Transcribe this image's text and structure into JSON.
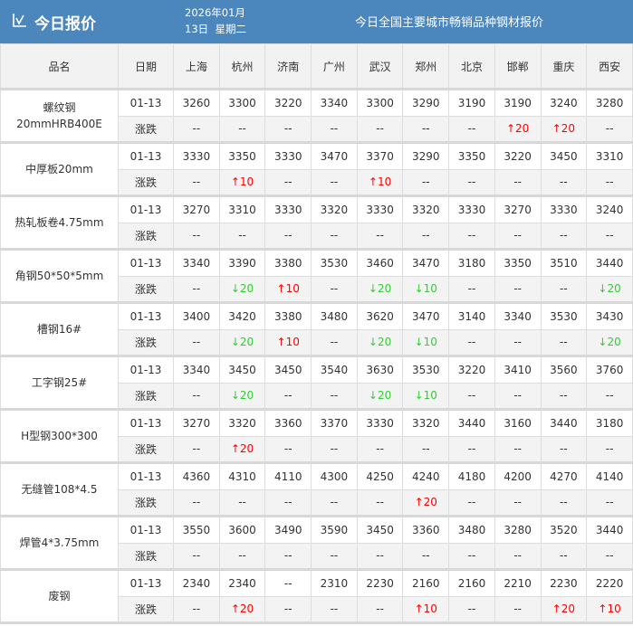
{
  "header": {
    "title": "今日报价",
    "date_line1": "2026年01月",
    "date_line2": "13日  星期二",
    "subtitle": "今日全国主要城市畅销品种钢材报价"
  },
  "colors": {
    "header_bg": "#4b86bd",
    "up": "#ff0000",
    "down": "#33cc33"
  },
  "table": {
    "col_name": "品名",
    "col_date": "日期",
    "cities": [
      "上海",
      "杭州",
      "济南",
      "广州",
      "武汉",
      "郑州",
      "北京",
      "邯郸",
      "重庆",
      "西安"
    ],
    "change_label": "涨跌",
    "products": [
      {
        "name": "螺纹钢\n20mmHRB400E",
        "date": "01-13",
        "prices": [
          "3260",
          "3300",
          "3220",
          "3340",
          "3300",
          "3290",
          "3190",
          "3190",
          "3240",
          "3280"
        ],
        "changes": [
          "--",
          "--",
          "--",
          "--",
          "--",
          "--",
          "--",
          "↑20",
          "↑20",
          "--"
        ]
      },
      {
        "name": "中厚板20mm",
        "date": "01-13",
        "prices": [
          "3330",
          "3350",
          "3330",
          "3470",
          "3370",
          "3290",
          "3350",
          "3220",
          "3450",
          "3310"
        ],
        "changes": [
          "--",
          "↑10",
          "--",
          "--",
          "↑10",
          "--",
          "--",
          "--",
          "--",
          "--"
        ]
      },
      {
        "name": "热轧板卷4.75mm",
        "date": "01-13",
        "prices": [
          "3270",
          "3310",
          "3330",
          "3320",
          "3330",
          "3320",
          "3330",
          "3270",
          "3330",
          "3240"
        ],
        "changes": [
          "--",
          "--",
          "--",
          "--",
          "--",
          "--",
          "--",
          "--",
          "--",
          "--"
        ]
      },
      {
        "name": "角钢50*50*5mm",
        "date": "01-13",
        "prices": [
          "3340",
          "3390",
          "3380",
          "3530",
          "3460",
          "3470",
          "3180",
          "3350",
          "3510",
          "3440"
        ],
        "changes": [
          "--",
          "↓20",
          "↑10",
          "--",
          "↓20",
          "↓10",
          "--",
          "--",
          "--",
          "↓20"
        ]
      },
      {
        "name": "槽钢16#",
        "date": "01-13",
        "prices": [
          "3400",
          "3420",
          "3380",
          "3480",
          "3620",
          "3470",
          "3140",
          "3340",
          "3530",
          "3430"
        ],
        "changes": [
          "--",
          "↓20",
          "↑10",
          "--",
          "↓20",
          "↓10",
          "--",
          "--",
          "--",
          "↓20"
        ]
      },
      {
        "name": "工字钢25#",
        "date": "01-13",
        "prices": [
          "3340",
          "3450",
          "3450",
          "3540",
          "3630",
          "3530",
          "3220",
          "3410",
          "3560",
          "3760"
        ],
        "changes": [
          "--",
          "↓20",
          "--",
          "--",
          "↓20",
          "↓10",
          "--",
          "--",
          "--",
          "--"
        ]
      },
      {
        "name": "H型钢300*300",
        "date": "01-13",
        "prices": [
          "3270",
          "3320",
          "3360",
          "3370",
          "3330",
          "3320",
          "3440",
          "3160",
          "3440",
          "3180"
        ],
        "changes": [
          "--",
          "↑20",
          "--",
          "--",
          "--",
          "--",
          "--",
          "--",
          "--",
          "--"
        ]
      },
      {
        "name": "无缝管108*4.5",
        "date": "01-13",
        "prices": [
          "4360",
          "4310",
          "4110",
          "4300",
          "4250",
          "4240",
          "4180",
          "4200",
          "4270",
          "4140"
        ],
        "changes": [
          "--",
          "--",
          "--",
          "--",
          "--",
          "↑20",
          "--",
          "--",
          "--",
          "--"
        ]
      },
      {
        "name": "焊管4*3.75mm",
        "date": "01-13",
        "prices": [
          "3550",
          "3600",
          "3490",
          "3590",
          "3450",
          "3360",
          "3480",
          "3280",
          "3520",
          "3440"
        ],
        "changes": [
          "--",
          "--",
          "--",
          "--",
          "--",
          "--",
          "--",
          "--",
          "--",
          "--"
        ]
      },
      {
        "name": "废钢",
        "date": "01-13",
        "prices": [
          "2340",
          "2340",
          "--",
          "2310",
          "2230",
          "2160",
          "2160",
          "2210",
          "2230",
          "2220"
        ],
        "changes": [
          "--",
          "↑20",
          "--",
          "--",
          "--",
          "↑10",
          "--",
          "--",
          "↑20",
          "↑10"
        ]
      }
    ]
  }
}
